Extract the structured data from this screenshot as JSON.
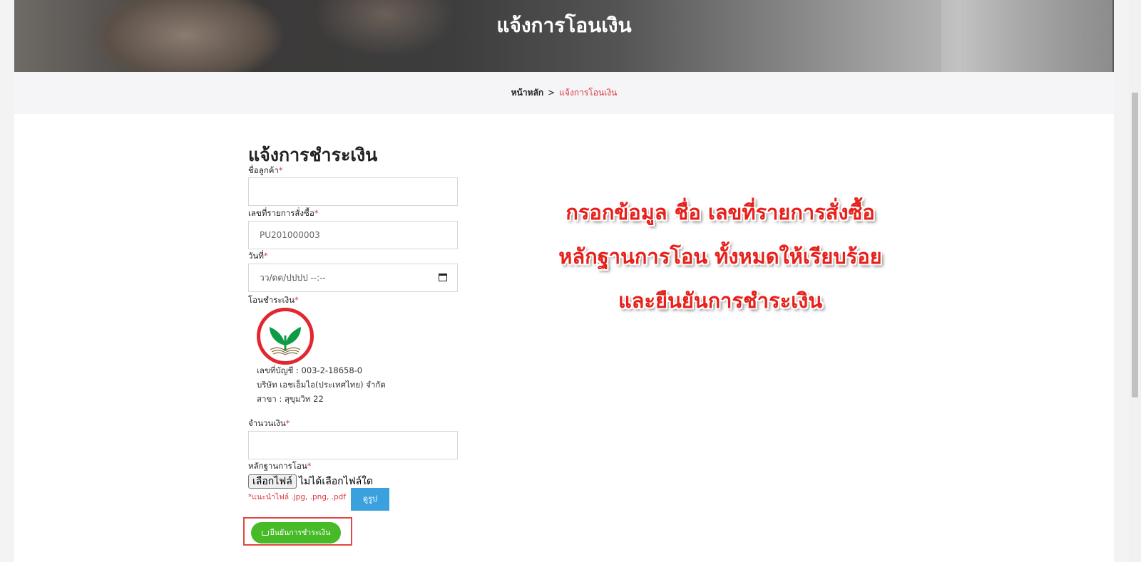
{
  "banner": {
    "title": "แจ้งการโอนเงิน"
  },
  "breadcrumb": {
    "home": "หน้าหลัก",
    "separator": ">",
    "current": "แจ้งการโอนเงิน"
  },
  "form": {
    "title": "แจ้งการชำระเงิน",
    "required_mark": "*",
    "customer_name": {
      "label": "ชื่อลูกค้า",
      "value": ""
    },
    "order_number": {
      "label": "เลขที่รายการสั่งซื้อ",
      "value": "PU201000003"
    },
    "date": {
      "label": "วันที่",
      "placeholder": "วว/ดด/ปปปป --:--"
    },
    "transfer": {
      "label": "โอนชำระเงิน",
      "account_line": "เลขที่บัญชี : 003-2-18658-0",
      "company_line": "บริษัท เอชเอ็มไอ(ประเทศไทย) จำกัด",
      "branch_line": "สาขา : สุขุมวิท 22"
    },
    "amount": {
      "label": "จำนวนเงิน",
      "value": ""
    },
    "evidence": {
      "label": "หลักฐานการโอน",
      "choose_file_label": "เลือกไฟล์",
      "no_file_text": "ไม่ได้เลือกไฟล์ใด",
      "hint": "*แนะนำไฟล์ .jpg, .png, .pdf",
      "view_button": "ดูรูป"
    },
    "submit_label": "ยืนยันการชำระเงิน"
  },
  "instructions": {
    "line1": "กรอกข้อมูล ชื่อ เลขที่รายการสั่งซื้อ",
    "line2": "หลักฐานการโอน ทั้งหมดให้เรียบร้อย",
    "line3": "และยืนยันการชำระเงิน"
  },
  "colors": {
    "accent_red": "#d9363e",
    "submit_green": "#46bb27",
    "view_blue": "#3ba1de",
    "highlight_red": "#e0483f",
    "bank_green": "#0e9b45"
  },
  "icons": {
    "bank_logo": "kasikorn-bank-logo",
    "submit": "cart-icon",
    "date": "calendar-icon"
  }
}
